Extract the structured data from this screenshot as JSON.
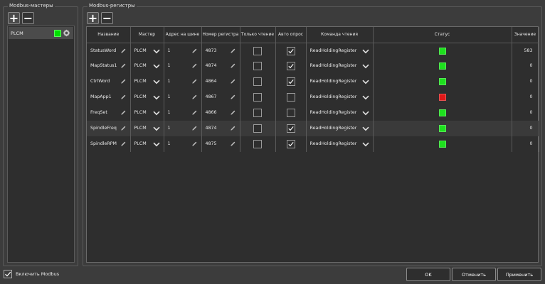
{
  "masters_panel": {
    "title": "Modbus-мастеры",
    "add_label": "+",
    "remove_label": "−",
    "items": [
      {
        "name": "PLCM",
        "status_color": "#00e000",
        "icon": "gear-icon"
      }
    ]
  },
  "registers_panel": {
    "title": "Modbus-регистры",
    "add_label": "+",
    "remove_label": "−",
    "columns": [
      "Название",
      "Мастер",
      "Адрес на шине",
      "Номер регистра",
      "Только чтение",
      "Авто опрос",
      "Команда чтения",
      "Статус",
      "Значение"
    ],
    "rows": [
      {
        "name": "StatusWord",
        "master": "PLCM",
        "address": "1",
        "register": "4873",
        "read_only": false,
        "auto_poll": true,
        "command": "ReadHoldingRegister",
        "status_color": "#1ee01e",
        "value": "583"
      },
      {
        "name": "MapStatus1",
        "master": "PLCM",
        "address": "1",
        "register": "4874",
        "read_only": false,
        "auto_poll": true,
        "command": "ReadHoldingRegister",
        "status_color": "#1ee01e",
        "value": "0"
      },
      {
        "name": "CtrlWord",
        "master": "PLCM",
        "address": "1",
        "register": "4864",
        "read_only": false,
        "auto_poll": true,
        "command": "ReadHoldingRegister",
        "status_color": "#1ee01e",
        "value": "0"
      },
      {
        "name": "MapApp1",
        "master": "PLCM",
        "address": "1",
        "register": "4867",
        "read_only": false,
        "auto_poll": false,
        "command": "ReadHoldingRegister",
        "status_color": "#e01818",
        "value": "0"
      },
      {
        "name": "FreqSet",
        "master": "PLCM",
        "address": "1",
        "register": "4866",
        "read_only": false,
        "auto_poll": false,
        "command": "ReadHoldingRegister",
        "status_color": "#1ee01e",
        "value": "0"
      },
      {
        "name": "SpindleFreq",
        "master": "PLCM",
        "address": "1",
        "register": "4874",
        "read_only": false,
        "auto_poll": true,
        "command": "ReadHoldingRegister",
        "status_color": "#1ee01e",
        "value": "0"
      },
      {
        "name": "SpindleRPM",
        "master": "PLCM",
        "address": "1",
        "register": "4875",
        "read_only": false,
        "auto_poll": true,
        "command": "ReadHoldingRegister",
        "status_color": "#1ee01e",
        "value": "0"
      }
    ]
  },
  "footer": {
    "enable_modbus_label": "Включить Modbus",
    "enable_modbus_checked": true,
    "ok_label": "OK",
    "cancel_label": "Отменить",
    "apply_label": "Применить"
  }
}
